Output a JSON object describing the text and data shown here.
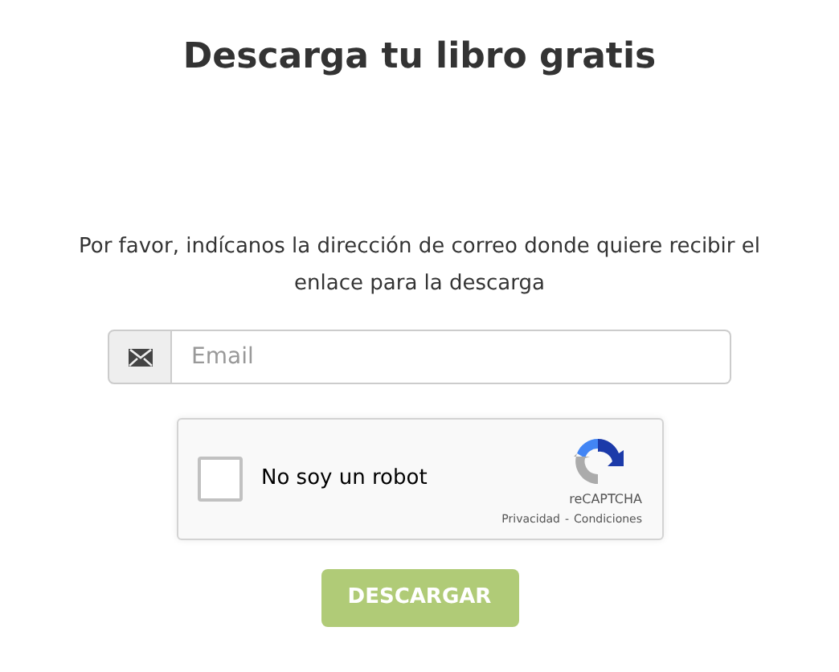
{
  "title": "Descarga tu libro gratis",
  "message": "Por favor, indícanos la dirección de correo donde quiere recibir el enlace para la descarga",
  "email_field": {
    "placeholder": "Email"
  },
  "captcha": {
    "checked": false,
    "label": "No soy un robot",
    "brand": "reCAPTCHA",
    "links": [
      "Privacidad",
      "Condiciones"
    ],
    "separator": "-"
  },
  "submit_button": {
    "label": "DESCARGAR",
    "disabled": true
  }
}
